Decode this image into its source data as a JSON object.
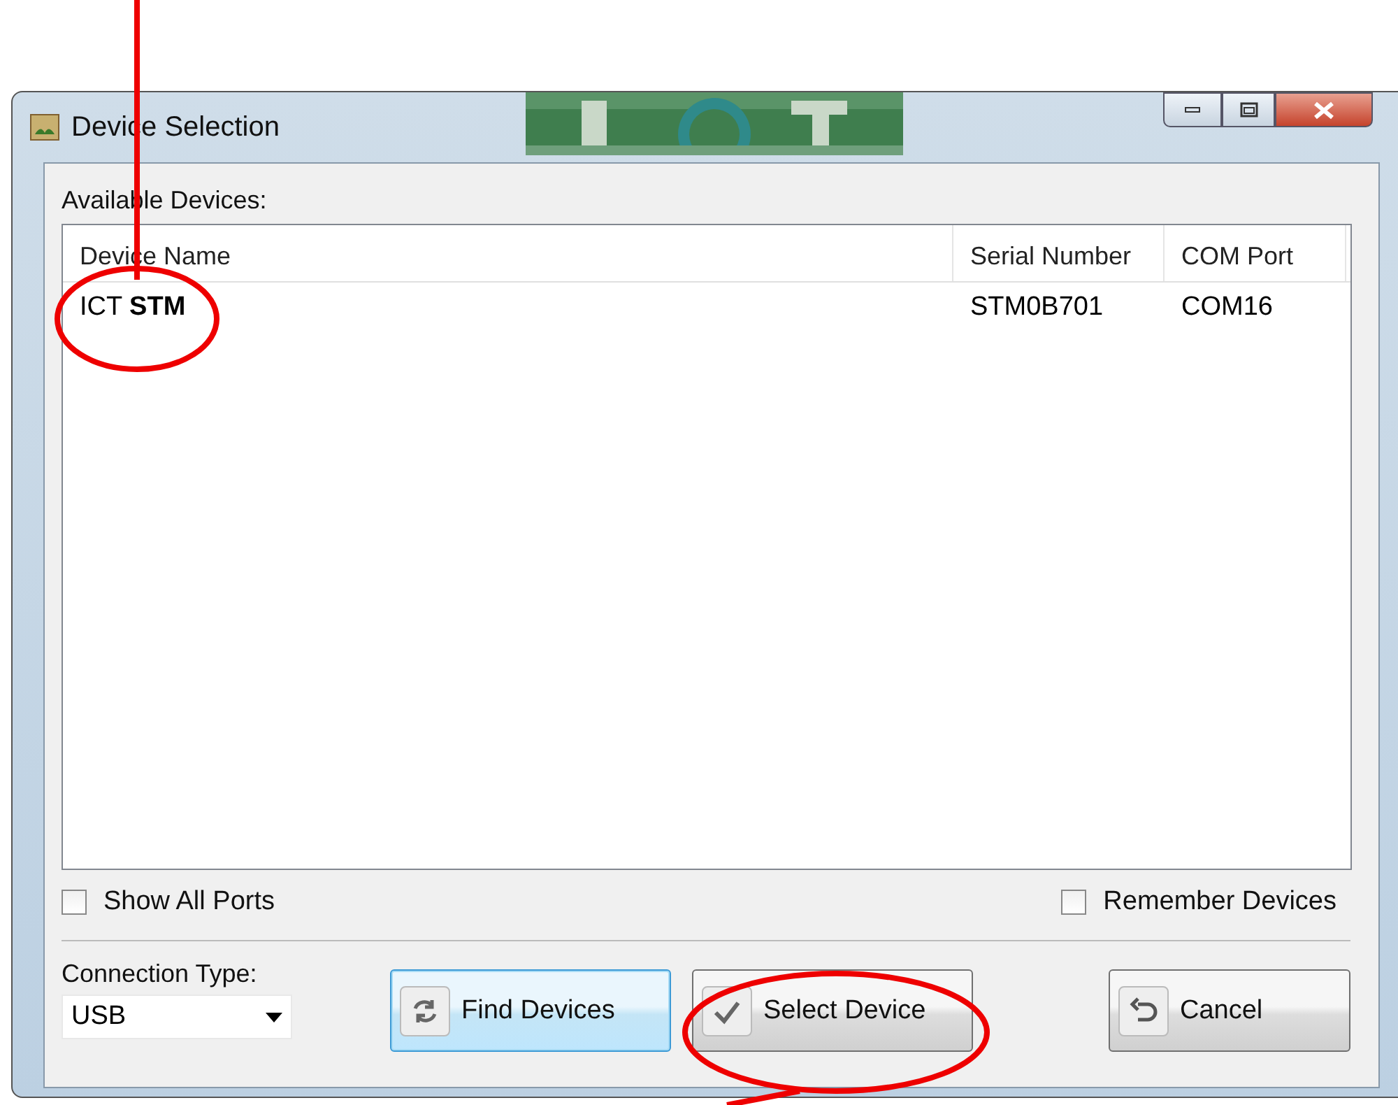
{
  "window": {
    "title": "Device Selection",
    "controls": [
      {
        "kind": "minimize"
      },
      {
        "kind": "maximize"
      },
      {
        "kind": "close"
      }
    ]
  },
  "list_label": "Available Devices:",
  "table": {
    "columns": [
      "Device Name",
      "Serial Number",
      "COM Port"
    ],
    "rows": [
      {
        "cells": [
          "ICT **STM**",
          "STM0B701",
          "COM16"
        ],
        "selected": false
      }
    ]
  },
  "options": [
    {
      "label": "Show All Ports",
      "checked": false
    },
    {
      "label": "Remember Devices",
      "checked": false
    }
  ],
  "connection": {
    "label": "Connection Type:",
    "value": "USB"
  },
  "buttons": [
    {
      "label": "Find Devices",
      "kind": "refresh",
      "focused": true
    },
    {
      "label": "Select Device",
      "kind": "check",
      "focused": false
    },
    {
      "label": "Cancel",
      "kind": "undo",
      "focused": false
    }
  ],
  "annotations": [
    {
      "kind": "callout"
    },
    {
      "kind": "callout"
    }
  ]
}
